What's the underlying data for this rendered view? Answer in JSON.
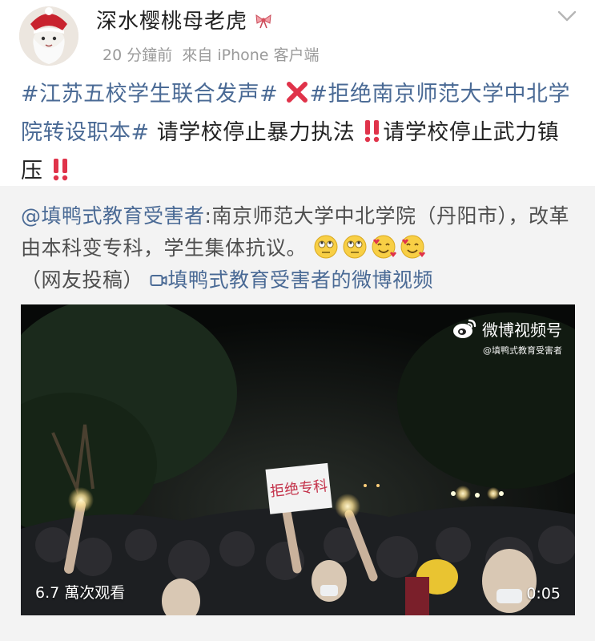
{
  "post": {
    "username": "深水樱桃母老虎",
    "timestamp": "20 分鐘前",
    "source": "來自 iPhone 客户端",
    "main_text": {
      "topic1": "#江苏五校学生联合发声#",
      "topic2": "#拒绝南京师范大学中北学院转设职本#",
      "body1": " 请学校停止暴力执法",
      "body2": "请学校停止武力镇压"
    }
  },
  "repost": {
    "author_mention": "@填鸭式教育受害者",
    "text": ":南京师范大学中北学院（丹阳市），改革由本科变专科，学生集体抗议。",
    "contributor_note": "（网友投稿）",
    "video_link": "填鸭式教育受害者的微博视频"
  },
  "video": {
    "watermark_title": "微博视频号",
    "watermark_account": "@填鸭式教育受害者",
    "sign_text": "拒绝专科",
    "views": "6.7 萬次观看",
    "duration": "0:05"
  },
  "icons": {
    "cross": "cross-mark-icon",
    "double_exclamation": "double-exclamation-icon",
    "link_video": "video-link-icon",
    "menu": "chevron-down-icon"
  },
  "colors": {
    "topic_link": "#4a6a95",
    "cross_red": "#e0334a",
    "exclamation_red": "#e0334a",
    "card_bg": "#f3f3f3"
  }
}
